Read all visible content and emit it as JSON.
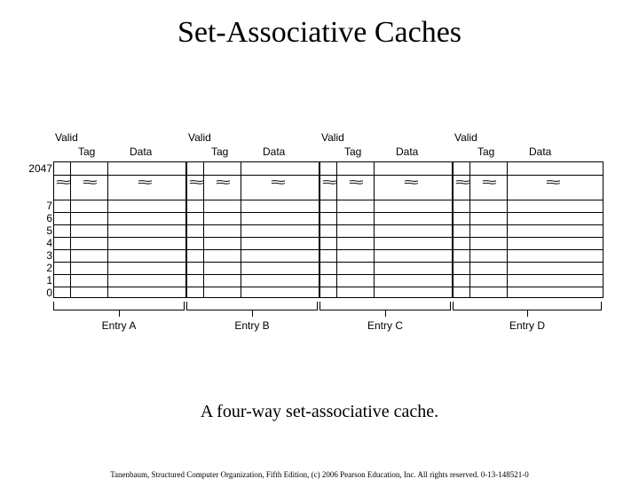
{
  "title": "Set-Associative Caches",
  "caption": "A four-way set-associative cache.",
  "footer": "Tanenbaum, Structured Computer Organization, Fifth Edition, (c) 2006 Pearson Education, Inc. All rights reserved. 0-13-148521-0",
  "top_index": "2047",
  "indices": [
    "7",
    "6",
    "5",
    "4",
    "3",
    "2",
    "1",
    "0"
  ],
  "col_labels": {
    "valid": "Valid",
    "tag": "Tag",
    "data": "Data"
  },
  "entries": [
    "Entry A",
    "Entry B",
    "Entry C",
    "Entry D"
  ]
}
